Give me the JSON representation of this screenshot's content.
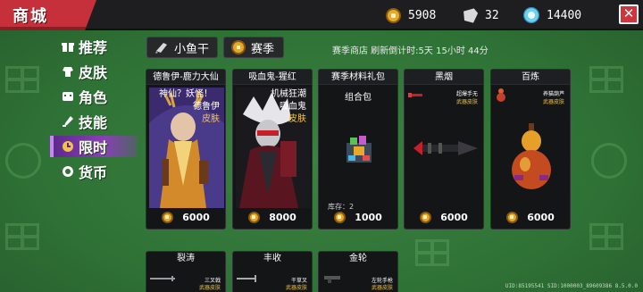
{
  "header": {
    "title": "商城",
    "currencies": [
      {
        "icon": "gold-coin-icon",
        "amount": "5908"
      },
      {
        "icon": "dried-fish-icon",
        "amount": "32"
      },
      {
        "icon": "gem-icon",
        "amount": "14400"
      }
    ],
    "close_label": "✕"
  },
  "sidebar": {
    "items": [
      {
        "label": "推荐",
        "icon": "gift-icon"
      },
      {
        "label": "皮肤",
        "icon": "skin-icon"
      },
      {
        "label": "角色",
        "icon": "character-icon"
      },
      {
        "label": "技能",
        "icon": "skill-icon"
      },
      {
        "label": "限时",
        "icon": "limited-time-icon",
        "active": true
      },
      {
        "label": "货币",
        "icon": "currency-icon"
      }
    ]
  },
  "filters": {
    "fish_label": "小鱼干",
    "season_label": "赛季"
  },
  "season_info": "赛季商店 刷新倒计时:5天 15小时 44分",
  "cards": [
    {
      "name": "德鲁伊-鹿力大仙",
      "lines": [
        "神仙？妖怪！",
        "德鲁伊"
      ],
      "tag": "皮肤",
      "price": "6000"
    },
    {
      "name": "吸血鬼-猩红",
      "lines": [
        "机械狂潮",
        "吸血鬼"
      ],
      "tag": "皮肤",
      "price": "8000"
    },
    {
      "name": "赛季材料礼包",
      "lines": [
        "组合包"
      ],
      "stock": "库存：2",
      "price": "1000"
    },
    {
      "name": "黑烟",
      "lines": [
        "超爆手无"
      ],
      "tag": "武器皮肤",
      "price": "6000"
    },
    {
      "name": "百炼",
      "lines": [
        "养猫葫芦"
      ],
      "tag": "武器皮肤",
      "price": "6000"
    }
  ],
  "bottom_cards": [
    {
      "name": "裂涛",
      "lines": [
        "三叉戟"
      ],
      "tag": "武器皮肤"
    },
    {
      "name": "丰收",
      "lines": [
        "干草叉"
      ],
      "tag": "武器皮肤"
    },
    {
      "name": "金轮",
      "lines": [
        "左轮手枪"
      ],
      "tag": "武器皮肤"
    }
  ],
  "build_info": "UID:85195541 SID:1000003_89609386 8.5.0.0",
  "colors": {
    "background": "#2f7236",
    "title_tab": "#c6303a",
    "active_tab": "#8a3fb8",
    "skin_tag": "#f2c23a"
  }
}
